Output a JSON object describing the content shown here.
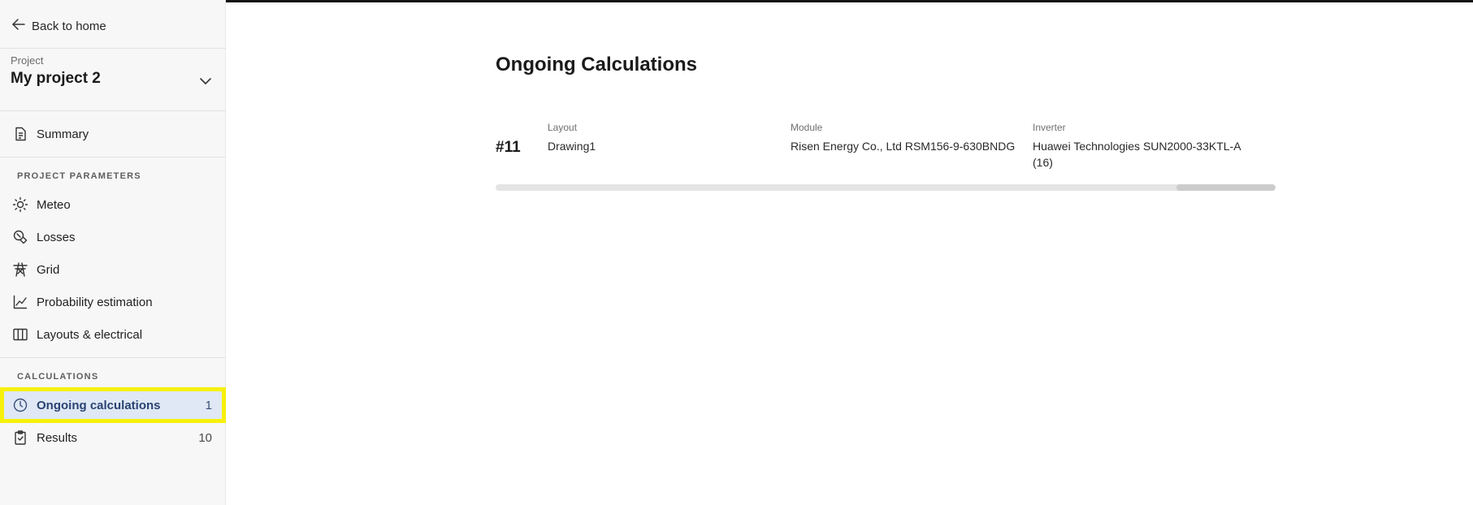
{
  "sidebar": {
    "back_label": "Back to home",
    "project": {
      "label": "Project",
      "name": "My project 2"
    },
    "summary_label": "Summary",
    "project_parameters_header": "PROJECT PARAMETERS",
    "parameters": [
      {
        "label": "Meteo",
        "icon": "sun-icon"
      },
      {
        "label": "Losses",
        "icon": "losses-icon"
      },
      {
        "label": "Grid",
        "icon": "transmission-tower-icon"
      },
      {
        "label": "Probability estimation",
        "icon": "line-chart-icon"
      },
      {
        "label": "Layouts & electrical",
        "icon": "columns-icon"
      }
    ],
    "calculations_header": "CALCULATIONS",
    "calculations": [
      {
        "label": "Ongoing calculations",
        "count": "1",
        "icon": "clock-icon",
        "active": true
      },
      {
        "label": "Results",
        "count": "10",
        "icon": "clipboard-check-icon",
        "active": false
      }
    ]
  },
  "main": {
    "title": "Ongoing Calculations",
    "calculations": [
      {
        "id": "#11",
        "layout_label": "Layout",
        "layout_value": "Drawing1",
        "module_label": "Module",
        "module_value": "Risen Energy Co., Ltd RSM156-9-630BNDG",
        "inverter_label": "Inverter",
        "inverter_value_line1": "Huawei Technologies SUN2000-33KTL-A",
        "inverter_value_line2": "(16)"
      }
    ]
  },
  "colors": {
    "active_bg": "#dfe8f4",
    "highlight": "#f7f00a",
    "active_text": "#2a4373",
    "sidebar_bg": "#f7f7f7",
    "progress_track": "#e4e4e4",
    "progress_fill": "#cccccc"
  }
}
